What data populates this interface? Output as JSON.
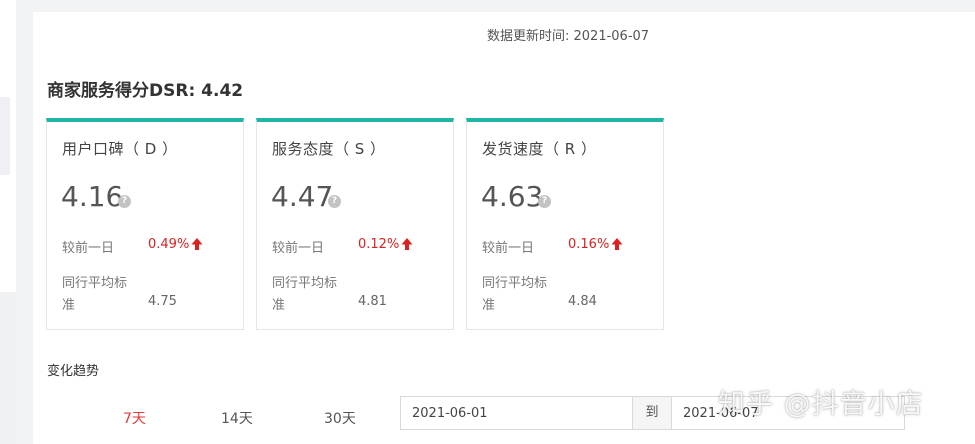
{
  "header": {
    "update_time": "数据更新时间: 2021-06-07",
    "dsr_title": "商家服务得分DSR: 4.42"
  },
  "cards": [
    {
      "title": "用户口碑（ D ）",
      "score": "4.16",
      "change_label": "较前一日",
      "change_value": "0.49%",
      "avg_label_line1": "同行平均标",
      "avg_label_line2": "准",
      "avg_value": "4.75"
    },
    {
      "title": "服务态度（ S ）",
      "score": "4.47",
      "change_label": "较前一日",
      "change_value": "0.12%",
      "avg_label_line1": "同行平均标",
      "avg_label_line2": "准",
      "avg_value": "4.81"
    },
    {
      "title": "发货速度（ R ）",
      "score": "4.63",
      "change_label": "较前一日",
      "change_value": "0.16%",
      "avg_label_line1": "同行平均标",
      "avg_label_line2": "准",
      "avg_value": "4.84"
    }
  ],
  "trend": {
    "title": "变化趋势",
    "tabs": [
      {
        "label": "7天",
        "active": true
      },
      {
        "label": "14天",
        "active": false
      },
      {
        "label": "30天",
        "active": false
      }
    ],
    "date_start": "2021-06-01",
    "date_separator": "到",
    "date_end": "2021-06-07"
  },
  "watermark": "知乎 @抖音小店",
  "colors": {
    "accent_teal": "#1fb6a6",
    "increase_red": "#e02020",
    "active_tab_red": "#e53935"
  },
  "icons": {
    "help": "question-circle-icon",
    "increase": "arrow-up-icon"
  }
}
